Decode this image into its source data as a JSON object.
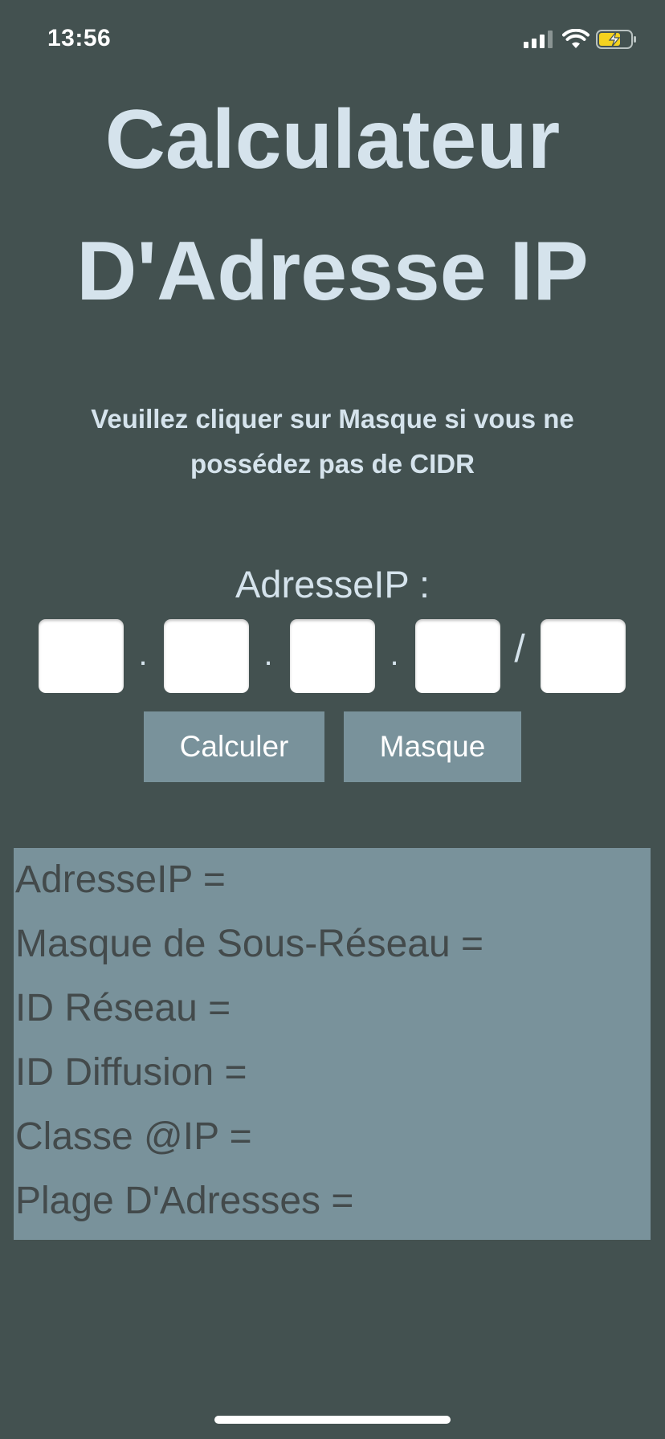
{
  "status_bar": {
    "time": "13:56",
    "icons": [
      "signal-icon",
      "wifi-icon",
      "battery-charging-icon"
    ],
    "battery_color": "#f4d21f"
  },
  "title": {
    "line1": "Calculateur",
    "line2": "D'Adresse IP"
  },
  "instruction": "Veuillez cliquer sur Masque si vous ne possédez pas de CIDR",
  "ip_entry": {
    "label": "AdresseIP :",
    "octets": [
      "",
      "",
      "",
      ""
    ],
    "cidr": "",
    "separator_dot": ".",
    "separator_slash": "/"
  },
  "buttons": {
    "calculate": "Calculer",
    "mask": "Masque"
  },
  "results": [
    "AdresseIP =",
    "Masque de Sous-Réseau =",
    "ID Réseau =",
    "ID Diffusion =",
    "Classe @IP =",
    "Plage D'Adresses ="
  ],
  "colors": {
    "background": "#435150",
    "title_text": "#d5e3ec",
    "button_bg": "#79929b",
    "results_bg": "#79929b",
    "results_text": "#434a4b"
  }
}
